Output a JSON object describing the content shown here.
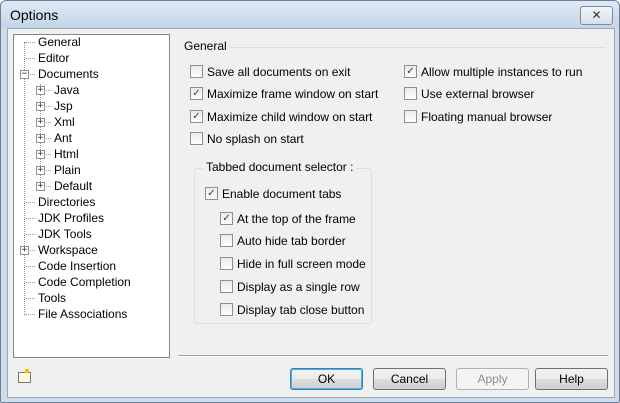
{
  "window": {
    "title": "Options",
    "close_glyph": "✕"
  },
  "tree": {
    "top": [
      {
        "label": "General"
      },
      {
        "label": "Editor"
      },
      {
        "label": "Documents",
        "expander": "−"
      },
      {
        "label": "Directories"
      },
      {
        "label": "JDK Profiles"
      },
      {
        "label": "JDK Tools"
      },
      {
        "label": "Workspace",
        "expander": "+"
      },
      {
        "label": "Code Insertion"
      },
      {
        "label": "Code Completion"
      },
      {
        "label": "Tools"
      },
      {
        "label": "File Associations"
      }
    ],
    "documents_children": [
      {
        "label": "Java",
        "expander": "+"
      },
      {
        "label": "Jsp",
        "expander": "+"
      },
      {
        "label": "Xml",
        "expander": "+"
      },
      {
        "label": "Ant",
        "expander": "+"
      },
      {
        "label": "Html",
        "expander": "+"
      },
      {
        "label": "Plain",
        "expander": "+"
      },
      {
        "label": "Default",
        "expander": "+"
      }
    ]
  },
  "general": {
    "legend": "General",
    "left_options": [
      {
        "label": "Save all documents on exit",
        "checked": false
      },
      {
        "label": "Maximize frame window on start",
        "checked": true
      },
      {
        "label": "Maximize child window on start",
        "checked": true
      },
      {
        "label": "No splash on start",
        "checked": false
      }
    ],
    "right_options": [
      {
        "label": "Allow multiple instances to run",
        "checked": true
      },
      {
        "label": "Use external browser",
        "checked": false
      },
      {
        "label": "Floating manual browser",
        "checked": false
      }
    ]
  },
  "tabbed": {
    "legend": "Tabbed document selector :",
    "enable": {
      "label": "Enable document tabs",
      "checked": true
    },
    "options": [
      {
        "label": "At the top of the frame",
        "checked": true
      },
      {
        "label": "Auto hide tab border",
        "checked": false
      },
      {
        "label": "Hide in full screen mode",
        "checked": false
      },
      {
        "label": "Display as a single row",
        "checked": false
      },
      {
        "label": "Display tab close button",
        "checked": false
      }
    ]
  },
  "buttons": {
    "ok": "OK",
    "cancel": "Cancel",
    "apply": "Apply",
    "help": "Help"
  },
  "check_glyph": "✓",
  "icons": {
    "new-folder": "folder-icon",
    "close": "close-icon",
    "check": "checkmark-icon"
  }
}
